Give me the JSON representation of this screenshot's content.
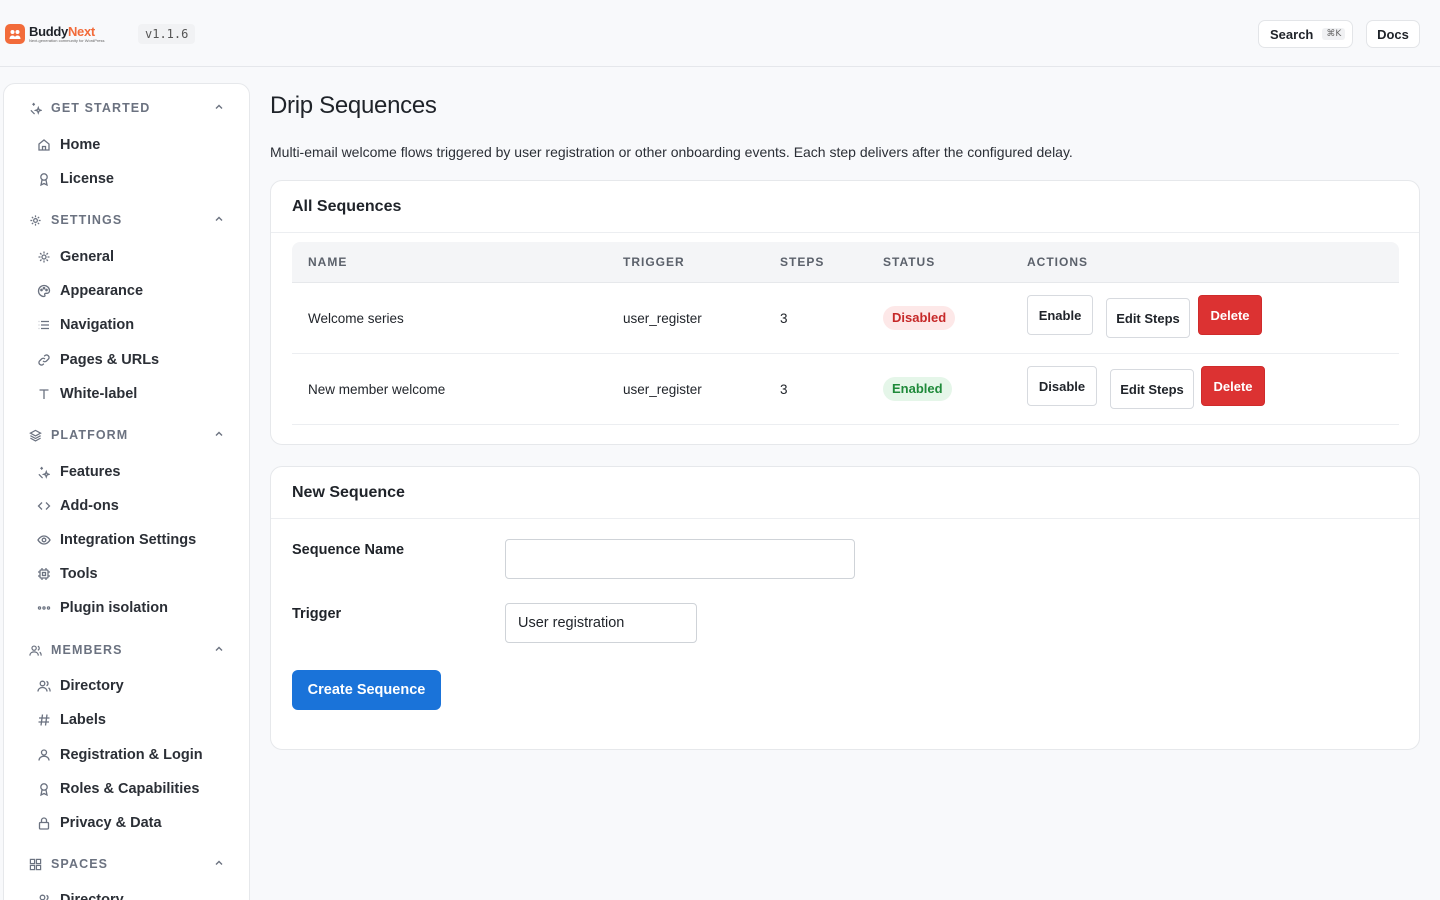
{
  "app": {
    "brand_name_part1": "Buddy",
    "brand_name_part2": "Next",
    "brand_tagline": "Next-generation community for WordPress",
    "version": "v1.1.6",
    "brand_color": "#f26b3a"
  },
  "header": {
    "search_label": "Search",
    "search_shortcut": "⌘K",
    "docs_label": "Docs"
  },
  "sidebar": {
    "sections": [
      {
        "title": "GET STARTED",
        "icon": "sparkle-icon",
        "items": [
          {
            "label": "Home",
            "icon": "home-icon"
          },
          {
            "label": "License",
            "icon": "award-icon"
          }
        ]
      },
      {
        "title": "SETTINGS",
        "icon": "gear-icon",
        "items": [
          {
            "label": "General",
            "icon": "gear-icon"
          },
          {
            "label": "Appearance",
            "icon": "palette-icon"
          },
          {
            "label": "Navigation",
            "icon": "list-icon"
          },
          {
            "label": "Pages & URLs",
            "icon": "link-icon"
          },
          {
            "label": "White-label",
            "icon": "type-icon"
          }
        ]
      },
      {
        "title": "PLATFORM",
        "icon": "layers-icon",
        "items": [
          {
            "label": "Features",
            "icon": "sparkle-icon"
          },
          {
            "label": "Add-ons",
            "icon": "code-icon"
          },
          {
            "label": "Integration Settings",
            "icon": "eye-icon"
          },
          {
            "label": "Tools",
            "icon": "cpu-icon"
          },
          {
            "label": "Plugin isolation",
            "icon": "dots-icon"
          }
        ]
      },
      {
        "title": "MEMBERS",
        "icon": "users-icon",
        "items": [
          {
            "label": "Directory",
            "icon": "users-icon"
          },
          {
            "label": "Labels",
            "icon": "hash-icon"
          },
          {
            "label": "Registration & Login",
            "icon": "user-icon"
          },
          {
            "label": "Roles & Capabilities",
            "icon": "award-icon"
          },
          {
            "label": "Privacy & Data",
            "icon": "lock-icon"
          }
        ]
      },
      {
        "title": "SPACES",
        "icon": "grid-icon",
        "items": [
          {
            "label": "Directory",
            "icon": "users-icon"
          }
        ]
      }
    ]
  },
  "main": {
    "title": "Drip Sequences",
    "description": "Multi-email welcome flows triggered by user registration or other onboarding events. Each step delivers after the configured delay.",
    "all_sequences": {
      "heading": "All Sequences",
      "columns": [
        "NAME",
        "TRIGGER",
        "STEPS",
        "STATUS",
        "ACTIONS"
      ],
      "rows": [
        {
          "name": "Welcome series",
          "trigger": "user_register",
          "steps": "3",
          "status": "Disabled",
          "toggle_label": "Enable",
          "edit_label": "Edit Steps",
          "delete_label": "Delete"
        },
        {
          "name": "New member welcome",
          "trigger": "user_register",
          "steps": "3",
          "status": "Enabled",
          "toggle_label": "Disable",
          "edit_label": "Edit Steps",
          "delete_label": "Delete"
        }
      ]
    },
    "new_sequence": {
      "heading": "New Sequence",
      "name_label": "Sequence Name",
      "name_value": "",
      "trigger_label": "Trigger",
      "trigger_value": "User registration",
      "create_label": "Create Sequence"
    }
  },
  "colors": {
    "primary": "#1a73d9",
    "danger": "#dc3232",
    "disabled_badge_bg": "#fde8e8",
    "enabled_badge_bg": "#e5f6e9"
  }
}
